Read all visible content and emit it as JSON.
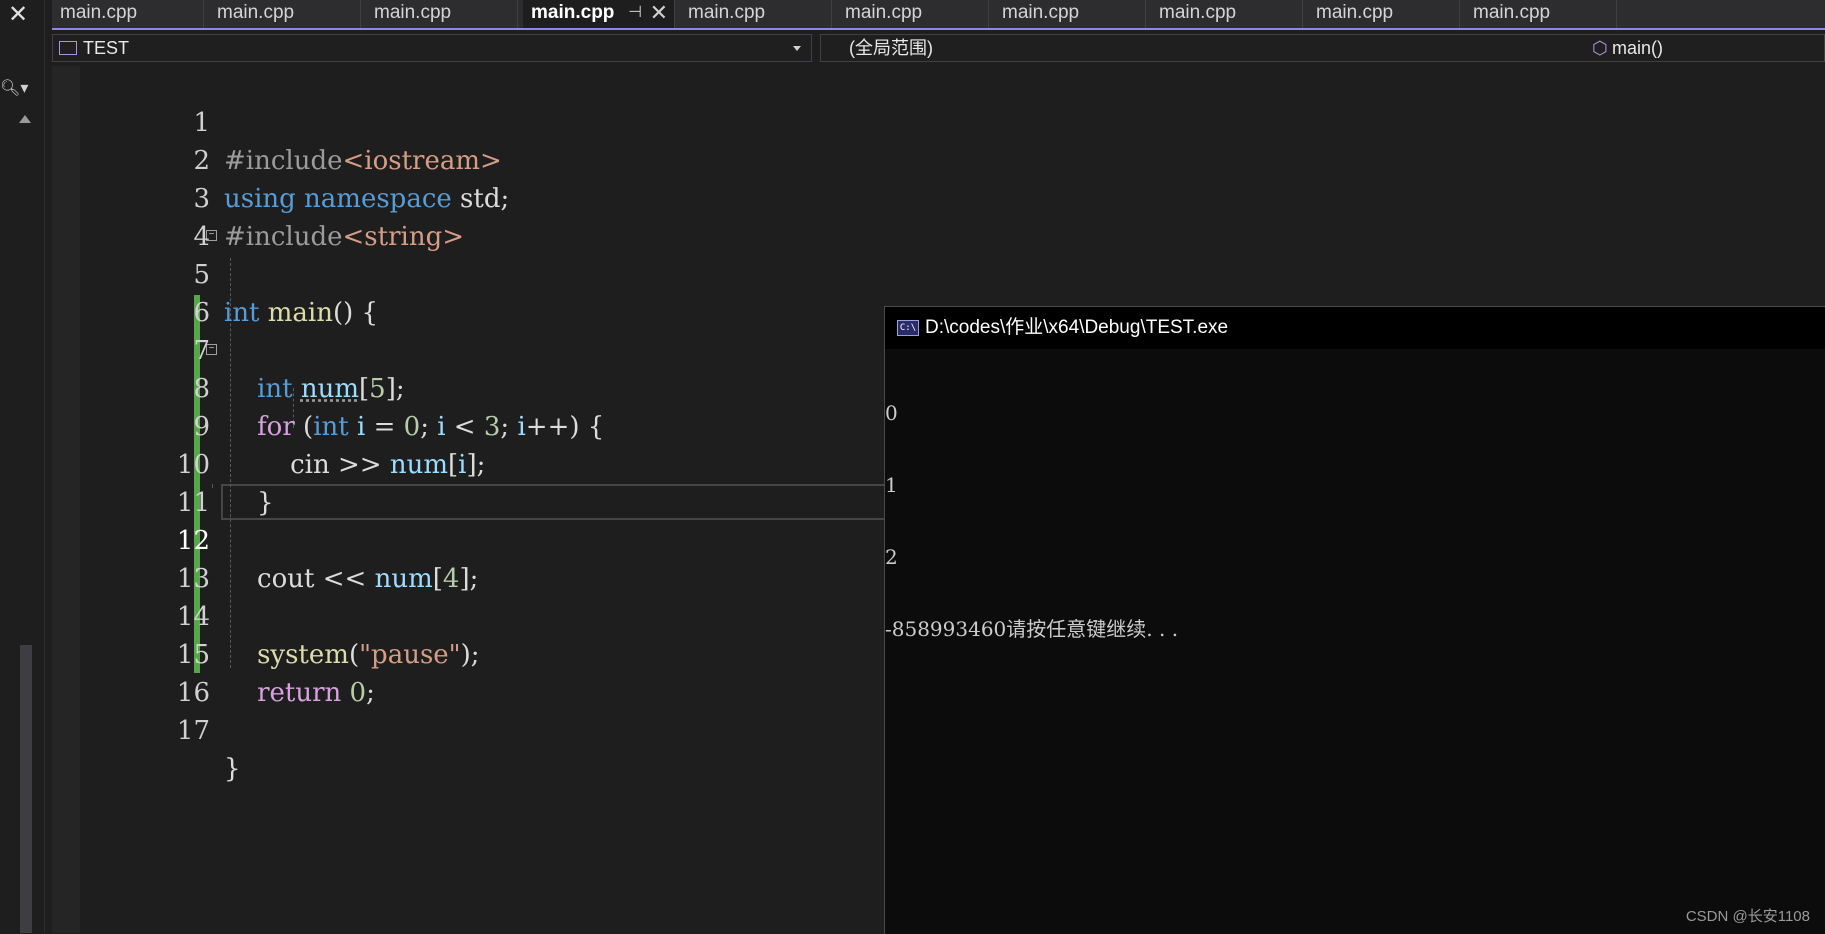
{
  "tabs": [
    {
      "label": "main.cpp"
    },
    {
      "label": "main.cpp"
    },
    {
      "label": "main.cpp"
    },
    {
      "label": "main.cpp",
      "active": true
    },
    {
      "label": "main.cpp"
    },
    {
      "label": "main.cpp"
    },
    {
      "label": "main.cpp"
    },
    {
      "label": "main.cpp"
    },
    {
      "label": "main.cpp"
    },
    {
      "label": "main.cpp"
    }
  ],
  "nav": {
    "project": "TEST",
    "scope": "(全局范围)",
    "member": "main()"
  },
  "code": [
    {
      "n": "1"
    },
    {
      "n": "2"
    },
    {
      "n": "3"
    },
    {
      "n": "4"
    },
    {
      "n": "5"
    },
    {
      "n": "6"
    },
    {
      "n": "7"
    },
    {
      "n": "8"
    },
    {
      "n": "9"
    },
    {
      "n": "10"
    },
    {
      "n": "11"
    },
    {
      "n": "12",
      "current": true
    },
    {
      "n": "13"
    },
    {
      "n": "14"
    },
    {
      "n": "15"
    },
    {
      "n": "16"
    },
    {
      "n": "17"
    }
  ],
  "console": {
    "title": "D:\\codes\\作业\\x64\\Debug\\TEST.exe",
    "icon_text": "C:\\",
    "lines": [
      "0",
      "1",
      "2",
      "-858993460请按任意键继续. . ."
    ]
  },
  "watermark": "CSDN @长安1108",
  "colors": {
    "keyword": "#569cd6",
    "control": "#d8a0df",
    "preprocessor": "#9b9b9b",
    "string": "#d69d85",
    "function": "#dcdcaa",
    "number": "#b5cea8",
    "variable": "#9cdcfe",
    "change_bar": "#57a64a",
    "tab_underline": "#9184ee"
  },
  "icons": [
    "close-icon",
    "search-icon",
    "pin-icon",
    "tab-close-icon",
    "project-icon",
    "member-cube-icon",
    "console-app-icon"
  ]
}
